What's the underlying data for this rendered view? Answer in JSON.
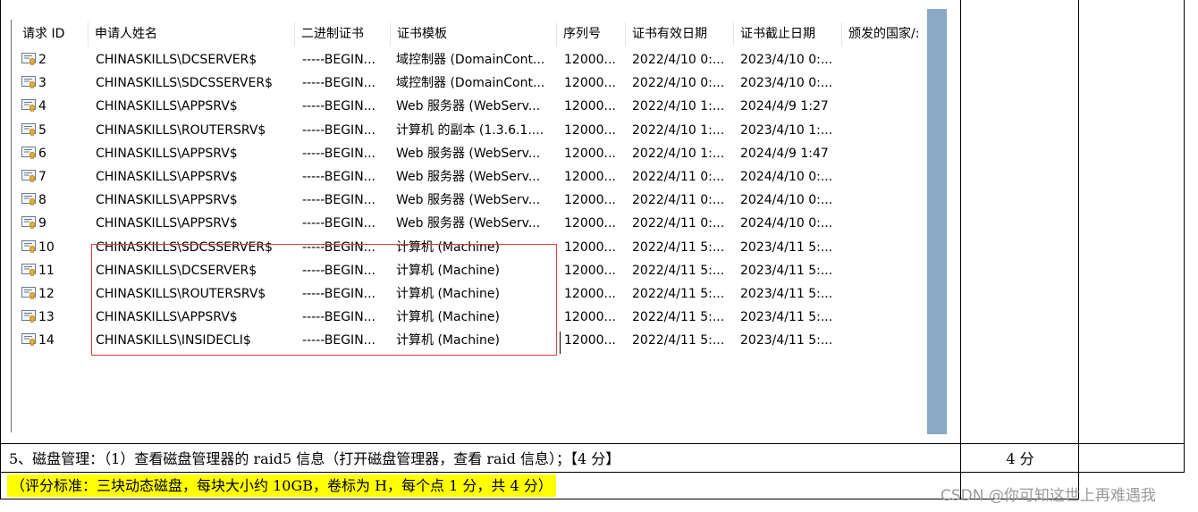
{
  "columns": [
    "请求 ID",
    "申请人姓名",
    "二进制证书",
    "证书模板",
    "序列号",
    "证书有效日期",
    "证书截止日期",
    "颁发的国家/:"
  ],
  "rows": [
    {
      "id": "2",
      "name": "CHINASKILLS\\DCSERVER$",
      "binary": "-----BEGIN...",
      "template": "域控制器 (DomainCont...",
      "serial": "12000...",
      "valid": "2022/4/10 0:...",
      "expire": "2023/4/10 0:..."
    },
    {
      "id": "3",
      "name": "CHINASKILLS\\SDCSSERVER$",
      "binary": "-----BEGIN...",
      "template": "域控制器 (DomainCont...",
      "serial": "12000...",
      "valid": "2022/4/10 0:...",
      "expire": "2023/4/10 0:..."
    },
    {
      "id": "4",
      "name": "CHINASKILLS\\APPSRV$",
      "binary": "-----BEGIN...",
      "template": "Web 服务器 (WebServ...",
      "serial": "12000...",
      "valid": "2022/4/10 1:...",
      "expire": "2024/4/9 1:27"
    },
    {
      "id": "5",
      "name": "CHINASKILLS\\ROUTERSRV$",
      "binary": "-----BEGIN...",
      "template": "计算机 的副本 (1.3.6.1....",
      "serial": "12000...",
      "valid": "2022/4/10 1:...",
      "expire": "2023/4/10 1:..."
    },
    {
      "id": "6",
      "name": "CHINASKILLS\\APPSRV$",
      "binary": "-----BEGIN...",
      "template": "Web 服务器 (WebServ...",
      "serial": "12000...",
      "valid": "2022/4/10 1:...",
      "expire": "2024/4/9 1:47"
    },
    {
      "id": "7",
      "name": "CHINASKILLS\\APPSRV$",
      "binary": "-----BEGIN...",
      "template": "Web 服务器 (WebServ...",
      "serial": "12000...",
      "valid": "2022/4/11 0:...",
      "expire": "2024/4/10 0:..."
    },
    {
      "id": "8",
      "name": "CHINASKILLS\\APPSRV$",
      "binary": "-----BEGIN...",
      "template": "Web 服务器 (WebServ...",
      "serial": "12000...",
      "valid": "2022/4/11 0:...",
      "expire": "2024/4/10 0:..."
    },
    {
      "id": "9",
      "name": "CHINASKILLS\\APPSRV$",
      "binary": "-----BEGIN...",
      "template": "Web 服务器 (WebServ...",
      "serial": "12000...",
      "valid": "2022/4/11 0:...",
      "expire": "2024/4/10 0:..."
    },
    {
      "id": "10",
      "name": "CHINASKILLS\\SDCSSERVER$",
      "binary": "-----BEGIN...",
      "template": "计算机 (Machine)",
      "serial": "12000...",
      "valid": "2022/4/11 5:...",
      "expire": "2023/4/11 5:..."
    },
    {
      "id": "11",
      "name": "CHINASKILLS\\DCSERVER$",
      "binary": "-----BEGIN...",
      "template": "计算机 (Machine)",
      "serial": "12000...",
      "valid": "2022/4/11 5:...",
      "expire": "2023/4/11 5:..."
    },
    {
      "id": "12",
      "name": "CHINASKILLS\\ROUTERSRV$",
      "binary": "-----BEGIN...",
      "template": "计算机 (Machine)",
      "serial": "12000...",
      "valid": "2022/4/11 5:...",
      "expire": "2023/4/11 5:..."
    },
    {
      "id": "13",
      "name": "CHINASKILLS\\APPSRV$",
      "binary": "-----BEGIN...",
      "template": "计算机 (Machine)",
      "serial": "12000...",
      "valid": "2022/4/11 5:...",
      "expire": "2023/4/11 5:..."
    },
    {
      "id": "14",
      "name": "CHINASKILLS\\INSIDECLI$",
      "binary": "-----BEGIN...",
      "template": "计算机 (Machine)",
      "serial": "12000...",
      "valid": "2022/4/11 5:...",
      "expire": "2023/4/11 5:..."
    }
  ],
  "task": {
    "text": "5、磁盘管理：（1）查看磁盘管理器的 raid5 信息（打开磁盘管理器，查看 raid 信息）；【4 分】",
    "score": "4 分",
    "criteria": "（评分标准：三块动态磁盘，每块大小约 10GB，卷标为 H，每个点 1 分，共 4 分）"
  },
  "watermark": "CSDN @你可知这世上再难遇我",
  "colors": {
    "highlight": "#ffff00",
    "scrollbar": "#8aa9c4",
    "selection_box": "#e0403c"
  },
  "icons": {
    "row_icon": "certificate-icon"
  }
}
